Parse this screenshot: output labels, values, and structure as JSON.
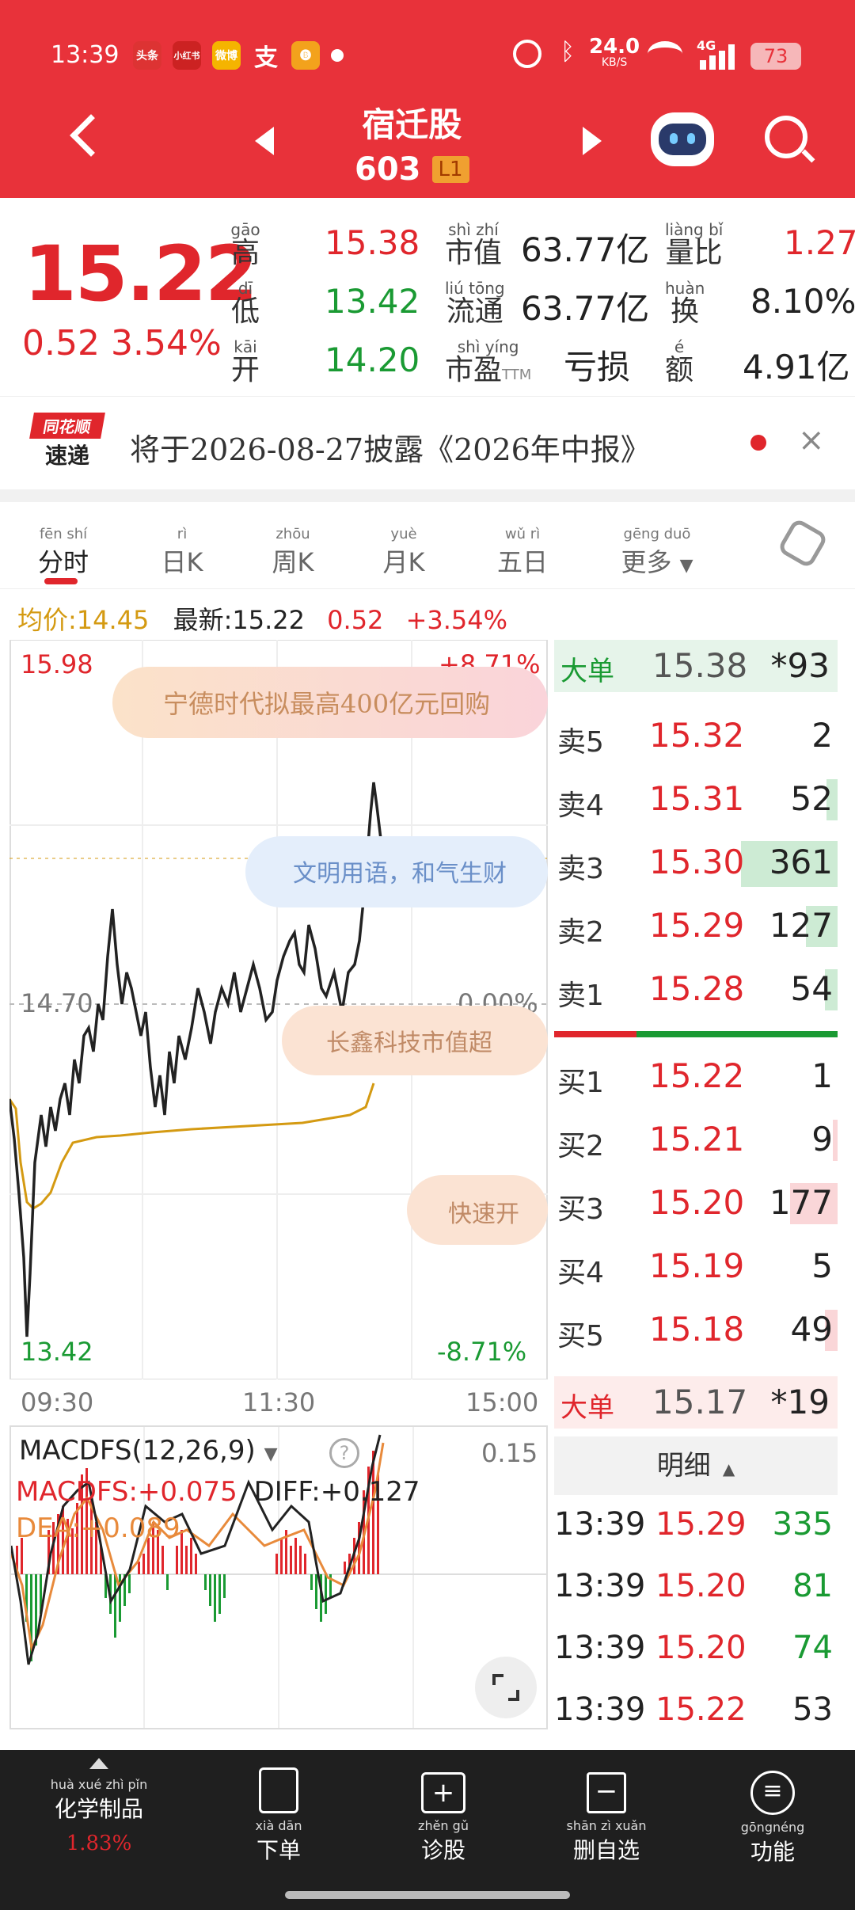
{
  "status_bar": {
    "time": "13:39",
    "app_icons": [
      "头条",
      "小红书",
      "微博",
      "支",
      "🅑"
    ],
    "net_speed": "24.0",
    "net_unit": "KB/S",
    "signal": "4G",
    "battery": "73"
  },
  "header": {
    "stock_name": "宿迁股",
    "stock_code": "603",
    "level_badge": "L1"
  },
  "quote": {
    "price": "15.22",
    "change": "0.52",
    "change_pct": "3.54%",
    "high_label": "高",
    "high_py": "gāo",
    "high": "15.38",
    "low_label": "低",
    "low_py": "dī",
    "low": "13.42",
    "open_label": "开",
    "open_py": "kāi",
    "open": "14.20",
    "mktcap_label": "市值",
    "mktcap_py": "shì zhí",
    "mktcap": "63.77亿",
    "float_label": "流通",
    "float_py": "liú tōng",
    "float": "63.77亿",
    "pe_label": "市盈",
    "pe_py": "shì yíng",
    "pe_suffix": "TTM",
    "pe": "亏损",
    "vr_label": "量比",
    "vr_py": "liàng bǐ",
    "vr": "1.27",
    "turnover_label": "换",
    "turnover_py": "huàn",
    "turnover": "8.10%",
    "amount_label": "额",
    "amount_py": "é",
    "amount": "4.91亿"
  },
  "news": {
    "logo_top": "同花顺",
    "logo_bottom": "速递",
    "text": "将于2026-08-27披露《2026年中报》"
  },
  "tabs": [
    {
      "label": "分时",
      "py": "fēn shí"
    },
    {
      "label": "日K",
      "py": "rì"
    },
    {
      "label": "周K",
      "py": "zhōu"
    },
    {
      "label": "月K",
      "py": "yuè"
    },
    {
      "label": "五日",
      "py": "wǔ rì"
    },
    {
      "label": "更多",
      "py": "gēng duō"
    }
  ],
  "chart_header": {
    "avg_label": "均价:14.45",
    "latest_label": "最新:15.22",
    "change": "0.52",
    "change_pct": "+3.54%"
  },
  "chart": {
    "max_price": "15.98",
    "max_pct": "+8.71%",
    "prev_close": "14.70",
    "zero_pct": "0.00%",
    "min_price": "13.42",
    "min_pct": "-8.71%",
    "t_start": "09:30",
    "t_mid": "11:30",
    "t_end": "15:00",
    "bubble1": "宁德时代拟最高400亿元回购",
    "bubble2": "文明用语，和气生财",
    "bubble3": "长鑫科技市值超",
    "bubble4": "快速开"
  },
  "macd": {
    "title": "MACDFS(12,26,9)",
    "scale": "0.15",
    "macd_value": "MACDFS:+0.075",
    "diff_value": "DIFF:+0.127",
    "dea_value": "DEA:+0.089"
  },
  "orderbook": {
    "big_sell_label": "大单",
    "big_sell_price": "15.38",
    "big_sell_vol": "*93",
    "asks": [
      {
        "label": "卖5",
        "price": "15.32",
        "vol": "2"
      },
      {
        "label": "卖4",
        "price": "15.31",
        "vol": "52"
      },
      {
        "label": "卖3",
        "price": "15.30",
        "vol": "361"
      },
      {
        "label": "卖2",
        "price": "15.29",
        "vol": "127"
      },
      {
        "label": "卖1",
        "price": "15.28",
        "vol": "54"
      }
    ],
    "bids": [
      {
        "label": "买1",
        "price": "15.22",
        "vol": "1"
      },
      {
        "label": "买2",
        "price": "15.21",
        "vol": "9"
      },
      {
        "label": "买3",
        "price": "15.20",
        "vol": "177"
      },
      {
        "label": "买4",
        "price": "15.19",
        "vol": "5"
      },
      {
        "label": "买5",
        "price": "15.18",
        "vol": "49"
      }
    ],
    "big_buy_label": "大单",
    "big_buy_price": "15.17",
    "big_buy_vol": "*19",
    "detail_label": "明细",
    "ticks": [
      {
        "time": "13:39",
        "price": "15.29",
        "vol": "335"
      },
      {
        "time": "13:39",
        "price": "15.20",
        "vol": "81"
      },
      {
        "time": "13:39",
        "price": "15.20",
        "vol": "74"
      },
      {
        "time": "13:39",
        "price": "15.22",
        "vol": "53"
      }
    ]
  },
  "bottom_nav": {
    "sector": "化学制品",
    "sector_py": "huà xué zhì pǐn",
    "sector_pct": "1.83%",
    "items": [
      {
        "label": "下单",
        "py": "xià dān"
      },
      {
        "label": "诊股",
        "py": "zhěn gǔ"
      },
      {
        "label": "删自选",
        "py": "shān zì xuǎn"
      },
      {
        "label": "功能",
        "py": "gōngnéng"
      }
    ]
  },
  "colors": {
    "header_red": "#e8323a",
    "up_red": "#e0262c",
    "down_green": "#1a9a33",
    "avg_gold": "#d49a12"
  }
}
